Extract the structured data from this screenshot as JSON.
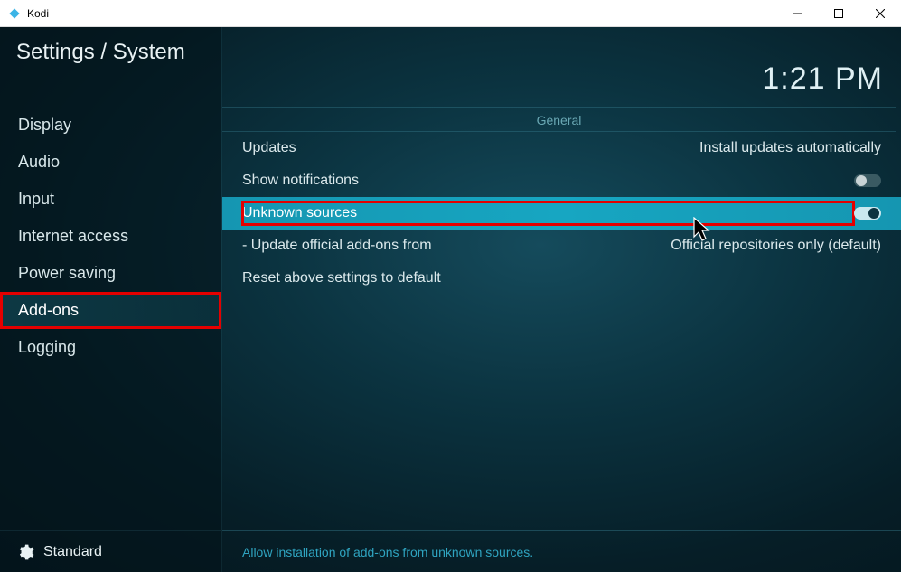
{
  "window": {
    "title": "Kodi"
  },
  "header": {
    "breadcrumb": "Settings / System",
    "clock": "1:21 PM"
  },
  "sidebar": {
    "items": [
      {
        "label": "Display",
        "selected": false
      },
      {
        "label": "Audio",
        "selected": false
      },
      {
        "label": "Input",
        "selected": false
      },
      {
        "label": "Internet access",
        "selected": false
      },
      {
        "label": "Power saving",
        "selected": false
      },
      {
        "label": "Add-ons",
        "selected": true,
        "annotated": true
      },
      {
        "label": "Logging",
        "selected": false
      }
    ],
    "footer_level": "Standard"
  },
  "content": {
    "section_title": "General",
    "settings": [
      {
        "label": "Updates",
        "type": "value",
        "value": "Install updates automatically"
      },
      {
        "label": "Show notifications",
        "type": "toggle",
        "toggled": false
      },
      {
        "label": "Unknown sources",
        "type": "toggle",
        "toggled": true,
        "highlight": true,
        "annotated": true
      },
      {
        "label": "- Update official add-ons from",
        "type": "value",
        "value": "Official repositories only (default)"
      },
      {
        "label": "Reset above settings to default",
        "type": "action"
      }
    ],
    "footer_hint": "Allow installation of add-ons from unknown sources."
  }
}
